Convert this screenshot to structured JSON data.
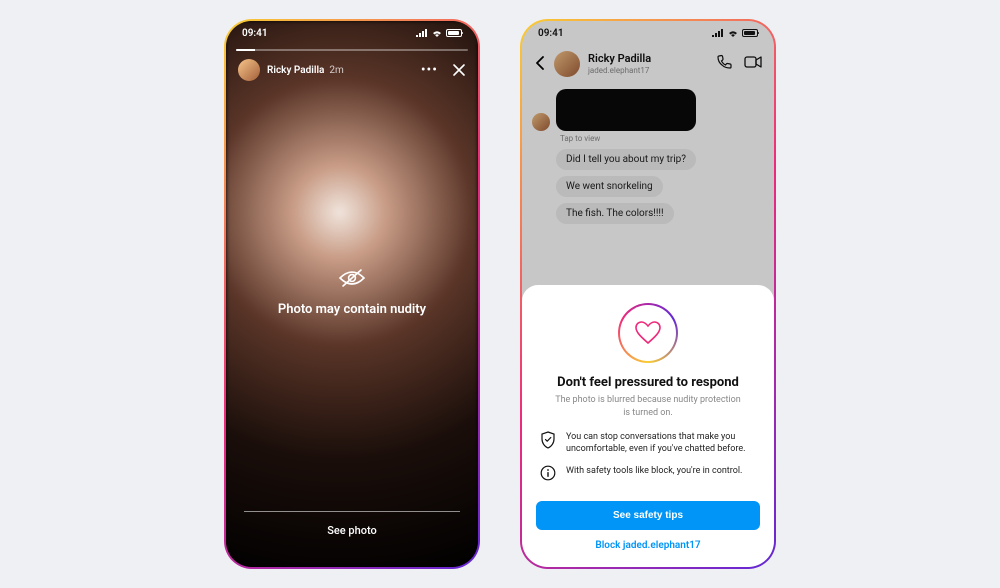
{
  "status": {
    "time": "09:41"
  },
  "story": {
    "user_name": "Ricky Padilla",
    "time_ago": "2m",
    "warning_text": "Photo may contain nudity",
    "see_photo_label": "See photo"
  },
  "dm": {
    "user_name": "Ricky Padilla",
    "user_handle": "jaded.elephant17",
    "tap_to_view": "Tap to view",
    "messages": [
      "Did I tell you about my trip?",
      "We went snorkeling",
      "The fish. The colors!!!!"
    ]
  },
  "sheet": {
    "title": "Don't feel pressured to respond",
    "subtitle": "The photo is blurred because nudity protection is turned on.",
    "tip1": "You can stop conversations that make you uncomfortable, even if you've chatted before.",
    "tip2": "With safety tools like block, you're in control.",
    "primary_button": "See safety tips",
    "secondary_link": "Block jaded.elephant17"
  }
}
